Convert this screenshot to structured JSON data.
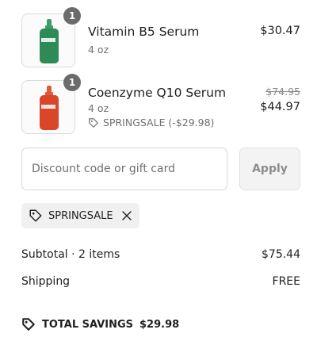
{
  "items": [
    {
      "name": "Vitamin B5 Serum",
      "variant": "4 oz",
      "quantity": "1",
      "price": "$30.47",
      "bottle_color": "#2e8b57"
    },
    {
      "name": "Coenzyme Q10 Serum",
      "variant": "4 oz",
      "quantity": "1",
      "compare_price": "$74.95",
      "price": "$44.97",
      "discount": "SPRINGSALE (-$29.98)",
      "bottle_color": "#d9472b"
    }
  ],
  "discount_input": {
    "placeholder": "Discount code or gift card",
    "value": ""
  },
  "apply_label": "Apply",
  "applied_code": "SPRINGSALE",
  "summary": {
    "subtotal_label": "Subtotal · 2 items",
    "subtotal_value": "$75.44",
    "shipping_label": "Shipping",
    "shipping_value": "FREE"
  },
  "total_savings_label": "TOTAL SAVINGS",
  "total_savings_value": "$29.98"
}
